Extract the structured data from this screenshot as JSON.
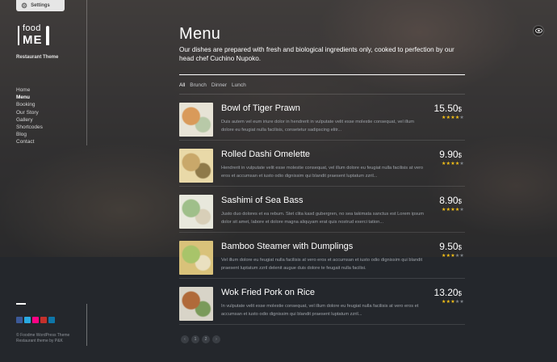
{
  "settings": {
    "label": "Settings",
    "icon": "gear-icon"
  },
  "brand": {
    "word1": "food",
    "word2": "ME",
    "tagline": "Restaurant Theme"
  },
  "nav": [
    {
      "label": "Home",
      "active": false
    },
    {
      "label": "Menu",
      "active": true
    },
    {
      "label": "Booking",
      "active": false
    },
    {
      "label": "Our Story",
      "active": false
    },
    {
      "label": "Gallery",
      "active": false
    },
    {
      "label": "Shortcodes",
      "active": false
    },
    {
      "label": "Blog",
      "active": false
    },
    {
      "label": "Contact",
      "active": false
    }
  ],
  "social": [
    {
      "icon": "facebook-icon",
      "color": "#3b5998"
    },
    {
      "icon": "twitter-icon",
      "color": "#29a9e1"
    },
    {
      "icon": "flickr-icon",
      "color": "#ff0084"
    },
    {
      "icon": "youtube-icon",
      "color": "#c4302b"
    },
    {
      "icon": "linkedin-icon",
      "color": "#0e76a8"
    }
  ],
  "footer": {
    "line1": "© Foodme WordPress Theme",
    "line2": "Restaurant theme by P&K"
  },
  "page": {
    "title": "Menu",
    "intro": "Our dishes are prepared with fresh and biological ingredients only, cooked to perfection by our head chef Cuchino Nupoko."
  },
  "filters": [
    "All",
    "Brunch",
    "Dinner",
    "Lunch"
  ],
  "active_filter": "All",
  "currency": "$",
  "items": [
    {
      "name": "Bowl of Tiger Prawn",
      "desc": "Duis autem vel eum iriure dolor in hendrerit in vulputate velit esse molestie consequat, vel illum dolore eu feugiat nulla facilisis, consetetur sadipscing elitr...",
      "price": "15.50",
      "rating": 4,
      "thumb_colors": [
        "#e7e3d6",
        "#d99a5a",
        "#b8c9a8"
      ]
    },
    {
      "name": "Rolled Dashi Omelette",
      "desc": "Hendrerit in vulputate velit esse molestie consequat, vel illum dolore eu feugiat nulla facilisis at vero eros et accumsan et iusto odio dignissim qui blandit praesent luptatum zzril...",
      "price": "9.90",
      "rating": 4,
      "thumb_colors": [
        "#e9d9a8",
        "#c9a86a",
        "#8f7a4a"
      ]
    },
    {
      "name": "Sashimi of Sea Bass",
      "desc": "Justo duo dolores et ea rebum. Stet clita kasd gubergren, no sea takimata sanctus est Lorem ipsum dolor sit amet, labore et dolore magna aliquyam erat quis nostrud exerci tation...",
      "price": "8.90",
      "rating": 4,
      "thumb_colors": [
        "#e8e8dc",
        "#9fbf8a",
        "#d8cfb8"
      ]
    },
    {
      "name": "Bamboo Steamer with Dumplings",
      "desc": "Vel illum dolore eu feugiat nulla facilisis at vero eros et accumsan et iusto odio dignissim qui blandit praesent luptatum zzril delenit augue duis dolore te feugait nulla facilisi.",
      "price": "9.50",
      "rating": 3,
      "thumb_colors": [
        "#d9c27a",
        "#a8c46a",
        "#eae0c0"
      ]
    },
    {
      "name": "Wok Fried Pork on Rice",
      "desc": "In vulputate velit esse molestie consequat, vel illum dolore eu feugiat nulla facilisis at vero eros et accumsan et iusto odio dignissim qui blandit praesent luptatum zzril...",
      "price": "13.20",
      "rating": 3,
      "thumb_colors": [
        "#d8d4c8",
        "#b06a3a",
        "#7a9a5a"
      ]
    }
  ],
  "pager": [
    "‹",
    "1",
    "2",
    "›"
  ]
}
